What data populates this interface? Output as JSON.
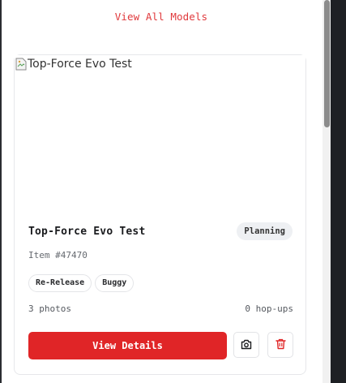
{
  "header": {
    "view_all_label": "View All Models"
  },
  "card": {
    "image_alt": "Top-Force Evo Test",
    "title": "Top-Force Evo Test",
    "status": "Planning",
    "item_number": "Item #47470",
    "tags": [
      "Re-Release",
      "Buggy"
    ],
    "photos": "3 photos",
    "hopups": "0 hop-ups",
    "details_label": "View Details",
    "photo_icon": "camera-icon",
    "delete_icon": "trash-icon"
  },
  "colors": {
    "accent": "#e02527",
    "link": "#e0393c"
  }
}
